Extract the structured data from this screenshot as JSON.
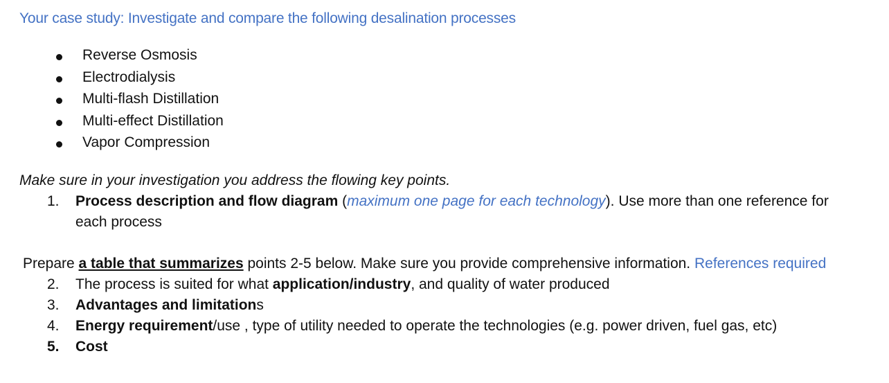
{
  "heading": "Your case study: Investigate and compare the following desalination processes",
  "processes": [
    "Reverse Osmosis",
    "Electrodialysis",
    "Multi-flash Distillation",
    "Multi-effect Distillation",
    "Vapor Compression"
  ],
  "intro": "Make sure in your investigation you address the flowing key points.",
  "point1": {
    "number": "1.",
    "bold": "Process description and flow diagram",
    "open_paren": " (",
    "note": "maximum one page for each technology",
    "rest": "). Use more than one reference for",
    "continuation": "each process"
  },
  "prepare": {
    "lead": "Prepare ",
    "underlined": "a table that summarizes",
    "middle": " points 2-5 below. Make sure you provide comprehensive information. ",
    "references": "References required"
  },
  "points": [
    {
      "number": "2.",
      "pre": "The process is suited for what ",
      "bold": "application/industry",
      "post": ", and quality of water produced"
    },
    {
      "number": "3.",
      "pre": "",
      "bold": "Advantages and limitation",
      "post": "s"
    },
    {
      "number": "4.",
      "pre": "",
      "bold": "Energy requirement",
      "post": "/use , type of utility needed to operate the technologies (e.g. power driven, fuel gas, etc)"
    },
    {
      "number": "5.",
      "pre": "",
      "bold": "Cost",
      "post": ""
    }
  ],
  "colors": {
    "accent_blue": "#4472c4",
    "text": "#111111"
  }
}
